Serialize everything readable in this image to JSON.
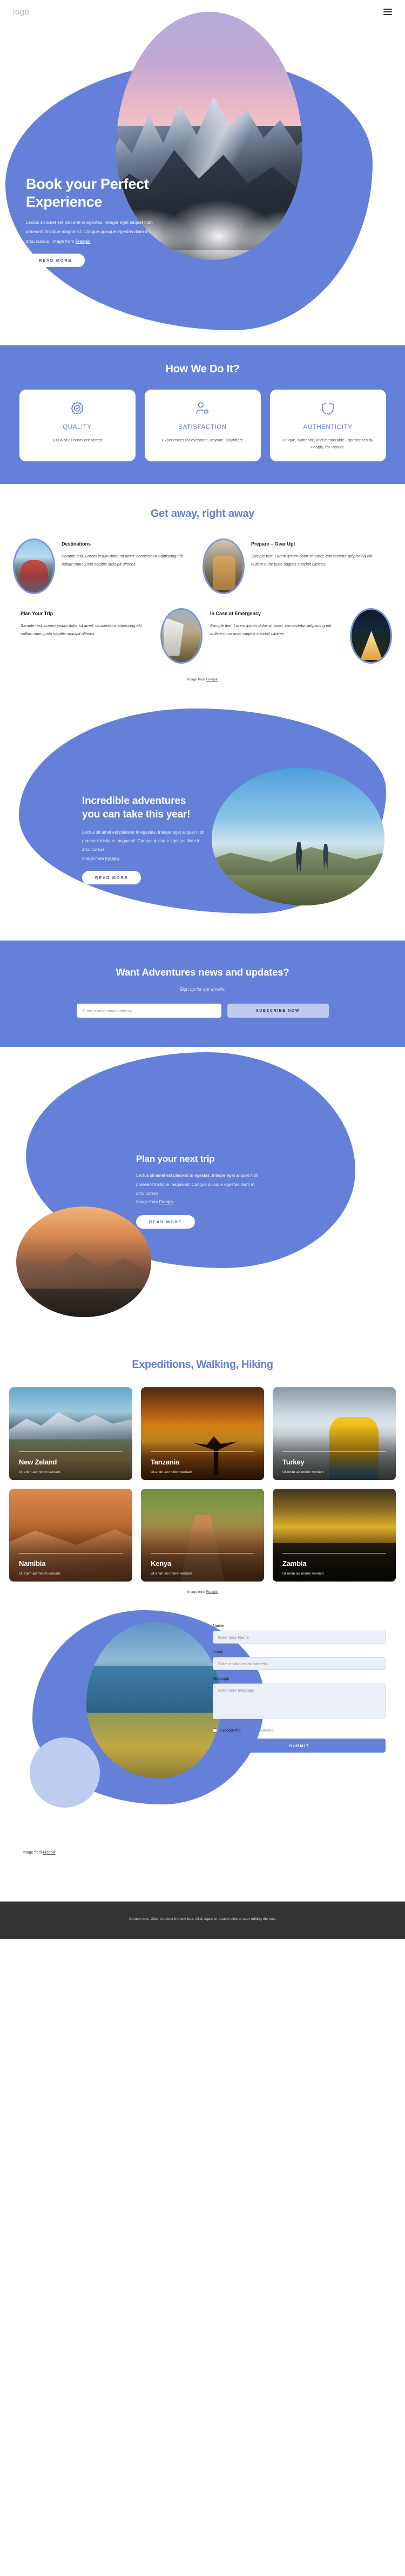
{
  "header": {
    "logo": "logo",
    "menu_icon": "hamburger-menu-icon"
  },
  "hero": {
    "title_line1": "Book your Perfect",
    "title_line2": "Experience",
    "paragraph": "Lectus sit amet est placerat in egestas. Integer eget aliquet nibh praesent tristique magna sit. Congue quisque egestas diam in arcu cursus. Image from ",
    "credit_link": "Freepik",
    "button": "READ MORE"
  },
  "how_we_do": {
    "title": "How We Do It?",
    "cards": [
      {
        "icon": "quality-badge-icon",
        "title": "QUALITY",
        "text": "100% of all hosts are vetted"
      },
      {
        "icon": "person-heart-icon",
        "title": "SATISFACTION",
        "text": "Experiences for everyone, anyone, anywhere"
      },
      {
        "icon": "shields-icon",
        "title": "AUTHENTICITY",
        "text": "Unique, authentic, and memorable Experiences by People, for People."
      }
    ]
  },
  "get_away": {
    "title": "Get away, right away",
    "body_text": "Sample text. Lorem ipsum dolor sit amet, consectetur adipiscing elit nullam nunc justo sagittis suscipit ultrices.",
    "items": [
      {
        "heading": "Destinations"
      },
      {
        "heading": "Prepare – Gear Up!"
      },
      {
        "heading": "Plan Your Trip"
      },
      {
        "heading": "In Case of Emergency"
      }
    ],
    "credit": "Image from ",
    "credit_link": "Freepik"
  },
  "incredible": {
    "title_line1": "Incredible adventures",
    "title_line2": "you can take this year!",
    "paragraph": "Lectus sit amet est placerat in egestas. Integer eget aliquet nibh praesent tristique magna sit. Congue quisque egestas diam in arcu cursus.",
    "credit": "Image from ",
    "credit_link": "Freepik",
    "button": "READ MORE"
  },
  "newsletter": {
    "title": "Want Adventures news and updates?",
    "subtitle": "Sign up for our emails.",
    "email_placeholder": "Enter a valid email address",
    "button": "SUBSCRIBE NOW"
  },
  "plan_trip": {
    "title": "Plan your next trip",
    "paragraph": "Lectus sit amet est placerat in egestas. Integer eget aliquet nibh praesent tristique magna sit. Congue quisque egestas diam in arcu cursus.",
    "credit": "Image from ",
    "credit_link": "Freepik",
    "button": "READ MORE"
  },
  "expeditions": {
    "title": "Expeditions, Walking, Hiking",
    "cards": [
      {
        "name": "New Zeland",
        "desc": "Ut enim ad minim veniam"
      },
      {
        "name": "Tanzania",
        "desc": "Ut enim ad minim veniam"
      },
      {
        "name": "Turkey",
        "desc": "Ut enim ad minim veniam"
      },
      {
        "name": "Namibia",
        "desc": "Ut enim ad minim veniam"
      },
      {
        "name": "Kenya",
        "desc": "Ut enim ad minim veniam"
      },
      {
        "name": "Zambia",
        "desc": "Ut enim ad minim veniam"
      }
    ],
    "credit": "Image from ",
    "credit_link": "Freepik"
  },
  "contact": {
    "name_label": "Name",
    "name_placeholder": "Enter your Name",
    "email_label": "Email",
    "email_placeholder": "Enter a valid email address",
    "message_label": "Message",
    "message_placeholder": "Enter your message",
    "accept_text": "I accept the ",
    "terms_link": "Terms of Service",
    "submit": "SUBMIT",
    "credit": "Image from ",
    "credit_link": "Freepik"
  },
  "footer": {
    "text": "Sample text. Click to select the text box. Click again or double click to start editing the text."
  },
  "colors": {
    "brand": "#6480d8",
    "brand_light": "#bdcbf0",
    "footer_bg": "#333333"
  }
}
